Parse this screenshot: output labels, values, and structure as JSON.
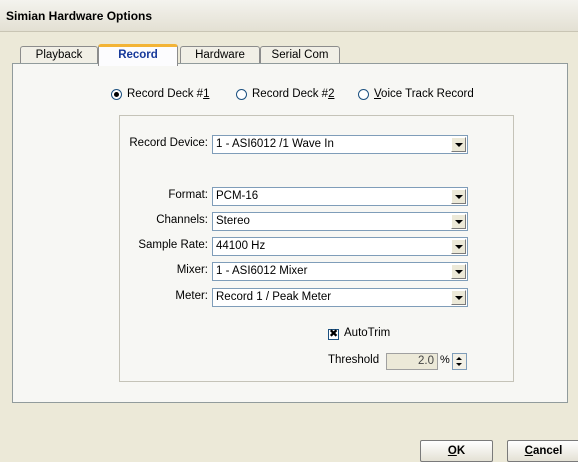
{
  "window": {
    "title": "Simian Hardware Options"
  },
  "tabs": [
    {
      "label": "Playback"
    },
    {
      "label": "Record",
      "active": true
    },
    {
      "label": "Hardware"
    },
    {
      "label": "Serial Com"
    }
  ],
  "record_deck": {
    "options": [
      {
        "label": "Record Deck #",
        "accel": "1",
        "checked": true
      },
      {
        "label": "Record Deck #",
        "accel": "2",
        "checked": false
      },
      {
        "accel": "V",
        "rest": "oice Track Record",
        "checked": false
      }
    ]
  },
  "fields": {
    "record_device": {
      "label": "Record Device:",
      "value": "1 - ASI6012 /1 Wave In"
    },
    "format": {
      "label": "Format:",
      "value": "PCM-16"
    },
    "channels": {
      "label": "Channels:",
      "value": "Stereo"
    },
    "sample_rate": {
      "label": "Sample Rate:",
      "value": "44100 Hz"
    },
    "mixer": {
      "label": "Mixer:",
      "value": "1 - ASI6012 Mixer"
    },
    "meter": {
      "label": "Meter:",
      "value": "Record 1 / Peak Meter"
    }
  },
  "autotrim": {
    "label": "AutoTrim",
    "checked": true
  },
  "threshold": {
    "label": "Threshold",
    "value": "2.0",
    "unit": "%"
  },
  "buttons": {
    "ok_accel": "O",
    "ok_rest": "K",
    "cancel_accel": "C",
    "cancel_rest": "ancel"
  }
}
